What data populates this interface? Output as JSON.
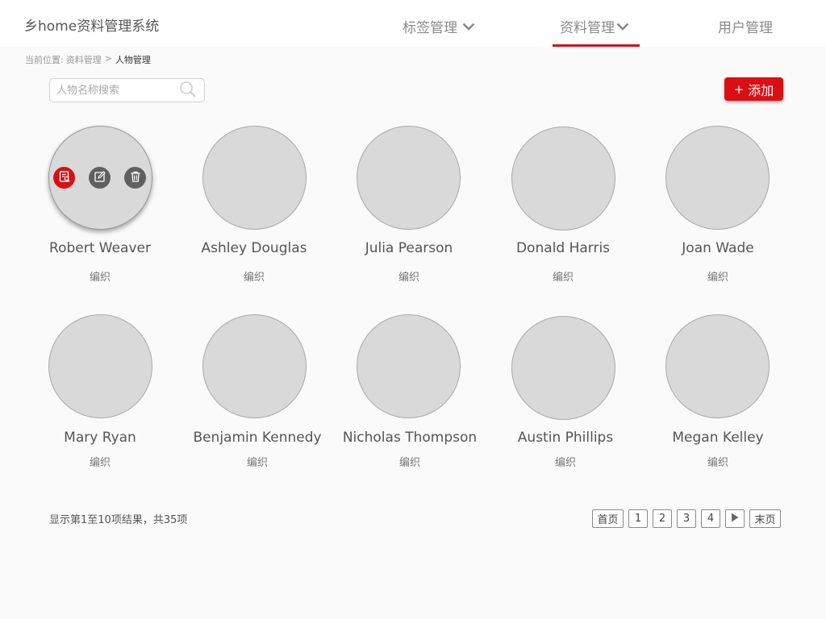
{
  "header": {
    "app_title": "乡home资料管理系统",
    "nav": [
      {
        "label": "标签管理",
        "dropdown": true
      },
      {
        "label": "资料管理",
        "dropdown": true,
        "active": true
      },
      {
        "label": "用户管理",
        "dropdown": false
      }
    ],
    "accent_color": "#c8161e"
  },
  "breadcrumb": {
    "prefix": "当前位置:",
    "parent": "资料管理",
    "separator": ">",
    "current": "人物管理"
  },
  "search": {
    "placeholder": "人物名称搜索",
    "value": "",
    "icon": "search-icon"
  },
  "add_button": {
    "icon": "+",
    "label": "添加",
    "color": "#d90f14"
  },
  "people": [
    {
      "name": "Robert Weaver",
      "role": "编织"
    },
    {
      "name": "Ashley Douglas",
      "role": "编织"
    },
    {
      "name": "Julia Pearson",
      "role": "编织"
    },
    {
      "name": "Donald Harris",
      "role": "编织"
    },
    {
      "name": "Joan Wade",
      "role": "编织"
    },
    {
      "name": "Mary Ryan",
      "role": "编织"
    },
    {
      "name": "Benjamin Kennedy",
      "role": "编织"
    },
    {
      "name": "Nicholas Thompson",
      "role": "编织"
    },
    {
      "name": "Austin Phillips",
      "role": "编织"
    },
    {
      "name": "Megan Kelley",
      "role": "编织"
    }
  ],
  "hover_actions": [
    "view-icon",
    "edit-icon",
    "delete-icon"
  ],
  "footer": {
    "summary": "显示第1至10项结果，共35项",
    "pagination": {
      "first": "首页",
      "pages": [
        "1",
        "2",
        "3",
        "4"
      ],
      "next_icon": "play-right-icon",
      "last": "末页"
    }
  }
}
